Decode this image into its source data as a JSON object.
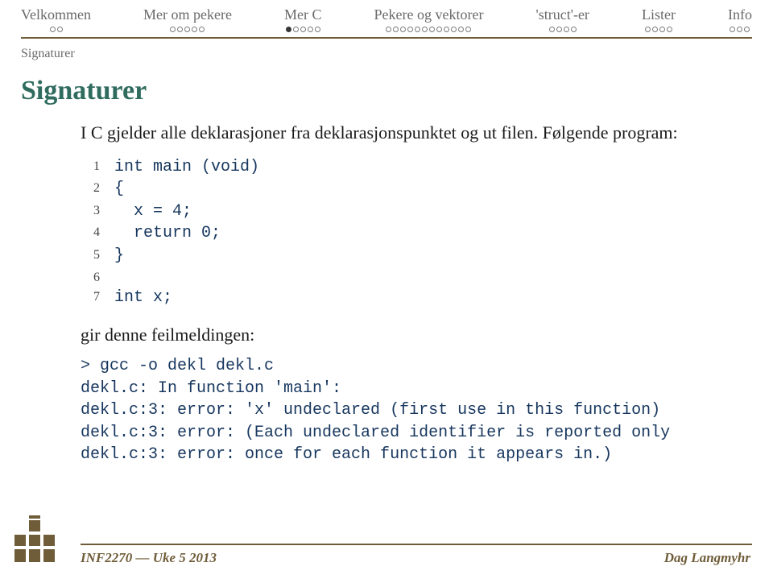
{
  "nav": [
    {
      "label": "Velkommen",
      "total": 2,
      "filled": 0
    },
    {
      "label": "Mer om pekere",
      "total": 5,
      "filled": 0
    },
    {
      "label": "Mer C",
      "total": 5,
      "filled": 1
    },
    {
      "label": "Pekere og vektorer",
      "total": 12,
      "filled": 0
    },
    {
      "label": "'struct'-er",
      "total": 4,
      "filled": 0
    },
    {
      "label": "Lister",
      "total": 4,
      "filled": 0
    },
    {
      "label": "Info",
      "total": 3,
      "filled": 0
    }
  ],
  "subtitle": "Signaturer",
  "title": "Signaturer",
  "paragraph1": "I C gjelder alle deklarasjoner fra deklarasjonspunktet og ut filen. Følgende program:",
  "code": [
    {
      "n": "1",
      "t": "int main (void)"
    },
    {
      "n": "2",
      "t": "{"
    },
    {
      "n": "3",
      "t": "  x = 4;"
    },
    {
      "n": "4",
      "t": "  return 0;"
    },
    {
      "n": "5",
      "t": "}"
    },
    {
      "n": "6",
      "t": ""
    },
    {
      "n": "7",
      "t": "int x;"
    }
  ],
  "paragraph2": "gir denne feilmeldingen:",
  "errors": [
    "> gcc -o dekl dekl.c",
    "dekl.c: In function 'main':",
    "dekl.c:3: error: 'x' undeclared (first use in this function)",
    "dekl.c:3: error: (Each undeclared identifier is reported only",
    "dekl.c:3: error: once for each function it appears in.)"
  ],
  "footer": {
    "left": "INF2270 — Uke 5 2013",
    "right": "Dag Langmyhr"
  }
}
